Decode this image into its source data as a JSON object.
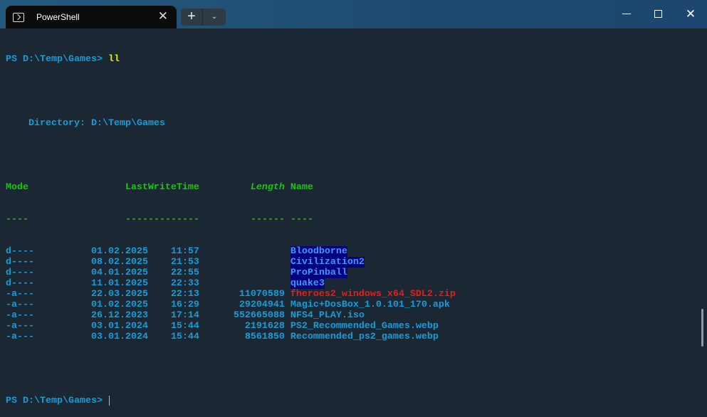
{
  "tab": {
    "title": "PowerShell",
    "close": "✕"
  },
  "toolbar": {
    "new_tab": "+",
    "dropdown": "⌄"
  },
  "window": {
    "minimize": "",
    "maximize": "",
    "close": "✕"
  },
  "terminal": {
    "prompt": "PS D:\\Temp\\Games> ",
    "command": "ll",
    "directory": "    Directory: D:\\Temp\\Games",
    "headers": {
      "mode": "Mode",
      "time": "LastWriteTime",
      "length": "Length",
      "name": "Name"
    },
    "underlines": {
      "mode": "----",
      "time": "-------------",
      "length": "------",
      "name": "----"
    },
    "rows": [
      {
        "mode": "d----",
        "date": "01.02.2025",
        "time": "11:57",
        "length": "",
        "name": "Bloodborne",
        "type": "dir"
      },
      {
        "mode": "d----",
        "date": "08.02.2025",
        "time": "21:53",
        "length": "",
        "name": "Civilization2",
        "type": "dir"
      },
      {
        "mode": "d----",
        "date": "04.01.2025",
        "time": "22:55",
        "length": "",
        "name": "ProPinball",
        "type": "dir"
      },
      {
        "mode": "d----",
        "date": "11.01.2025",
        "time": "22:33",
        "length": "",
        "name": "quake3",
        "type": "dir"
      },
      {
        "mode": "-a---",
        "date": "22.03.2025",
        "time": "22:13",
        "length": "11070589",
        "name": "fheroes2_windows_x64_SDL2.zip",
        "type": "archive"
      },
      {
        "mode": "-a---",
        "date": "01.02.2025",
        "time": "16:29",
        "length": "29204941",
        "name": "Magic+DosBox_1.0.101_170.apk",
        "type": "file"
      },
      {
        "mode": "-a---",
        "date": "26.12.2023",
        "time": "17:14",
        "length": "552665088",
        "name": "NFS4_PLAY.iso",
        "type": "file"
      },
      {
        "mode": "-a---",
        "date": "03.01.2024",
        "time": "15:44",
        "length": "2191628",
        "name": "PS2_Recommended_Games.webp",
        "type": "file"
      },
      {
        "mode": "-a---",
        "date": "03.01.2024",
        "time": "15:44",
        "length": "8561850",
        "name": "Recommended_ps2_games.webp",
        "type": "file"
      }
    ],
    "prompt2": "PS D:\\Temp\\Games> "
  }
}
